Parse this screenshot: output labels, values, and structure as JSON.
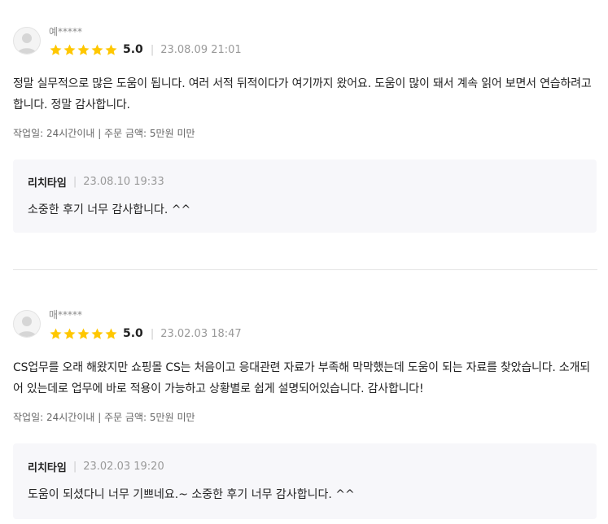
{
  "colors": {
    "star": "#ffc700",
    "reply_background": "#f7f7fa",
    "divider": "#e5e5e5"
  },
  "reviews": [
    {
      "author": "예*****",
      "rating": 5,
      "score": "5.0",
      "date": "23.08.09 21:01",
      "body": "정말 실무적으로 많은 도움이 됩니다. 여러 서적 뒤적이다가 여기까지 왔어요. 도움이 많이 돼서 계속 읽어 보면서 연습하려고 합니다. 정말 감사합니다.",
      "info": "작업일: 24시간이내 | 주문 금액: 5만원 미만",
      "reply": {
        "author": "리치타임",
        "date": "23.08.10 19:33",
        "text": "소중한 후기 너무 감사합니다. ^^"
      }
    },
    {
      "author": "매*****",
      "rating": 5,
      "score": "5.0",
      "date": "23.02.03 18:47",
      "body": "CS업무를 오래 해왔지만 쇼핑몰 CS는 처음이고 응대관련 자료가 부족해 막막했는데 도움이 되는 자료를 찾았습니다. 소개되어 있는데로 업무에 바로 적용이 가능하고 상황별로 쉽게 설명되어있습니다. 감사합니다!",
      "info": "작업일: 24시간이내 | 주문 금액: 5만원 미만",
      "reply": {
        "author": "리치타임",
        "date": "23.02.03 19:20",
        "text": "도움이 되셨다니 너무 기쁘네요.~ 소중한 후기 너무 감사합니다. ^^"
      }
    }
  ]
}
